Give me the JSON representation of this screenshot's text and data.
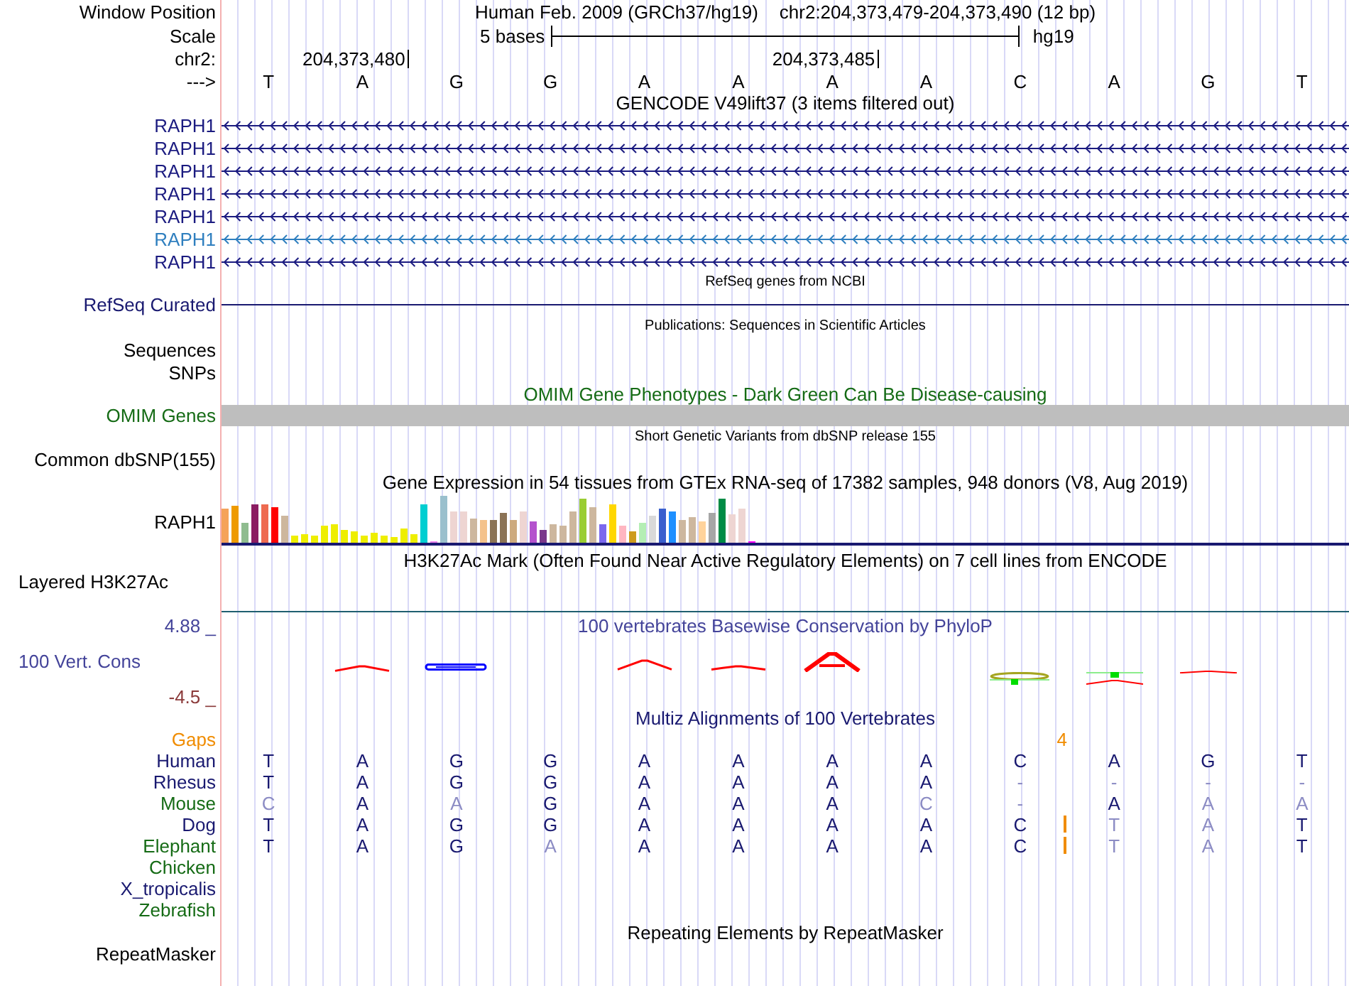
{
  "ruler": {
    "window_position": {
      "label": "Window Position",
      "assembly": "Human Feb. 2009 (GRCh37/hg19)",
      "range": "chr2:204,373,479-204,373,490 (12 bp)"
    },
    "scale": {
      "label": "Scale",
      "span": "5 bases",
      "assembly": "hg19"
    },
    "coordinates": {
      "label": "chr2:",
      "ticks": [
        "204,373,480",
        "204,373,485"
      ]
    },
    "sequence": {
      "label": "--->",
      "bases": [
        "T",
        "A",
        "G",
        "G",
        "A",
        "A",
        "A",
        "A",
        "C",
        "A",
        "G",
        "T"
      ]
    }
  },
  "tracks": [
    {
      "kind": "genes",
      "title": "GENCODE V49lift37 (3 items filtered out)",
      "items": [
        {
          "label": "RAPH1",
          "color": "#1b1b80"
        },
        {
          "label": "RAPH1",
          "color": "#1b1b80"
        },
        {
          "label": "RAPH1",
          "color": "#1b1b80"
        },
        {
          "label": "RAPH1",
          "color": "#1b1b80"
        },
        {
          "label": "RAPH1",
          "color": "#1b1b80"
        },
        {
          "label": "RAPH1",
          "color": "#2f7fbf"
        },
        {
          "label": "RAPH1",
          "color": "#1b1b80"
        }
      ]
    },
    {
      "kind": "refseq",
      "title": "RefSeq genes from NCBI",
      "label": "RefSeq Curated"
    },
    {
      "kind": "publications",
      "title": "Publications: Sequences in Scientific Articles",
      "labels": [
        "Sequences",
        "SNPs"
      ]
    },
    {
      "kind": "omim",
      "title": "OMIM Gene Phenotypes - Dark Green Can Be Disease-causing",
      "label": "OMIM Genes"
    },
    {
      "kind": "variants",
      "title": "Short Genetic Variants from dbSNP release 155",
      "label": "Common dbSNP(155)"
    },
    {
      "kind": "expression",
      "title": "Gene Expression in 54 tissues from GTEx RNA-seq of 17382 samples, 948 donors (V8, Aug 2019)",
      "label": "RAPH1"
    },
    {
      "kind": "chromatin",
      "title": "H3K27Ac Mark (Often Found Near Active Regulatory Elements) on 7 cell lines from ENCODE",
      "label": "Layered H3K27Ac"
    },
    {
      "kind": "conservation",
      "title": "100 vertebrates Basewise Conservation by PhyloP",
      "label": "100 Vert. Cons",
      "axis_max": "4.88 _",
      "axis_min": "-4.5 _"
    },
    {
      "kind": "alignment",
      "title": "Multiz Alignments of 100 Vertebrates",
      "gaps": {
        "label": "Gaps",
        "count": "4"
      },
      "species": [
        {
          "name": "Human",
          "color": "#191970",
          "bases": [
            {
              "base": "T",
              "match": true,
              "insertion_after": false
            },
            {
              "base": "A",
              "match": true,
              "insertion_after": false
            },
            {
              "base": "G",
              "match": true,
              "insertion_after": false
            },
            {
              "base": "G",
              "match": true,
              "insertion_after": false
            },
            {
              "base": "A",
              "match": true,
              "insertion_after": false
            },
            {
              "base": "A",
              "match": true,
              "insertion_after": false
            },
            {
              "base": "A",
              "match": true,
              "insertion_after": false
            },
            {
              "base": "A",
              "match": true,
              "insertion_after": false
            },
            {
              "base": "C",
              "match": true,
              "insertion_after": false
            },
            {
              "base": "A",
              "match": true,
              "insertion_after": false
            },
            {
              "base": "G",
              "match": true,
              "insertion_after": false
            },
            {
              "base": "T",
              "match": true,
              "insertion_after": false
            }
          ]
        },
        {
          "name": "Rhesus",
          "color": "#191970",
          "bases": [
            {
              "base": "T",
              "match": true,
              "insertion_after": false
            },
            {
              "base": "A",
              "match": true,
              "insertion_after": false
            },
            {
              "base": "G",
              "match": true,
              "insertion_after": false
            },
            {
              "base": "G",
              "match": true,
              "insertion_after": false
            },
            {
              "base": "A",
              "match": true,
              "insertion_after": false
            },
            {
              "base": "A",
              "match": true,
              "insertion_after": false
            },
            {
              "base": "A",
              "match": true,
              "insertion_after": false
            },
            {
              "base": "A",
              "match": true,
              "insertion_after": false
            },
            {
              "base": "-",
              "match": false,
              "insertion_after": false
            },
            {
              "base": "-",
              "match": false,
              "insertion_after": false
            },
            {
              "base": "-",
              "match": false,
              "insertion_after": false
            },
            {
              "base": "-",
              "match": false,
              "insertion_after": false
            }
          ]
        },
        {
          "name": "Mouse",
          "color": "#156b15",
          "bases": [
            {
              "base": "C",
              "match": false,
              "insertion_after": false
            },
            {
              "base": "A",
              "match": true,
              "insertion_after": false
            },
            {
              "base": "A",
              "match": false,
              "insertion_after": false
            },
            {
              "base": "G",
              "match": true,
              "insertion_after": false
            },
            {
              "base": "A",
              "match": true,
              "insertion_after": false
            },
            {
              "base": "A",
              "match": true,
              "insertion_after": false
            },
            {
              "base": "A",
              "match": true,
              "insertion_after": false
            },
            {
              "base": "C",
              "match": false,
              "insertion_after": false
            },
            {
              "base": "-",
              "match": false,
              "insertion_after": false
            },
            {
              "base": "A",
              "match": true,
              "insertion_after": false
            },
            {
              "base": "A",
              "match": false,
              "insertion_after": false
            },
            {
              "base": "A",
              "match": false,
              "insertion_after": false
            }
          ]
        },
        {
          "name": "Dog",
          "color": "#191970",
          "bases": [
            {
              "base": "T",
              "match": true,
              "insertion_after": false
            },
            {
              "base": "A",
              "match": true,
              "insertion_after": false
            },
            {
              "base": "G",
              "match": true,
              "insertion_after": false
            },
            {
              "base": "G",
              "match": true,
              "insertion_after": false
            },
            {
              "base": "A",
              "match": true,
              "insertion_after": false
            },
            {
              "base": "A",
              "match": true,
              "insertion_after": false
            },
            {
              "base": "A",
              "match": true,
              "insertion_after": false
            },
            {
              "base": "A",
              "match": true,
              "insertion_after": false
            },
            {
              "base": "C",
              "match": true,
              "insertion_after": true
            },
            {
              "base": "T",
              "match": false,
              "insertion_after": false
            },
            {
              "base": "A",
              "match": false,
              "insertion_after": false
            },
            {
              "base": "T",
              "match": true,
              "insertion_after": false
            }
          ]
        },
        {
          "name": "Elephant",
          "color": "#156b15",
          "bases": [
            {
              "base": "T",
              "match": true,
              "insertion_after": false
            },
            {
              "base": "A",
              "match": true,
              "insertion_after": false
            },
            {
              "base": "G",
              "match": true,
              "insertion_after": false
            },
            {
              "base": "A",
              "match": false,
              "insertion_after": false
            },
            {
              "base": "A",
              "match": true,
              "insertion_after": false
            },
            {
              "base": "A",
              "match": true,
              "insertion_after": false
            },
            {
              "base": "A",
              "match": true,
              "insertion_after": false
            },
            {
              "base": "A",
              "match": true,
              "insertion_after": false
            },
            {
              "base": "C",
              "match": true,
              "insertion_after": true
            },
            {
              "base": "T",
              "match": false,
              "insertion_after": false
            },
            {
              "base": "A",
              "match": false,
              "insertion_after": false
            },
            {
              "base": "T",
              "match": true,
              "insertion_after": false
            }
          ]
        },
        {
          "name": "Chicken",
          "color": "#156b15"
        },
        {
          "name": "X_tropicalis",
          "color": "#191970"
        },
        {
          "name": "Zebrafish",
          "color": "#156b15"
        }
      ]
    },
    {
      "kind": "repeats",
      "title": "Repeating Elements by RepeatMasker",
      "label": "RepeatMasker"
    }
  ]
}
